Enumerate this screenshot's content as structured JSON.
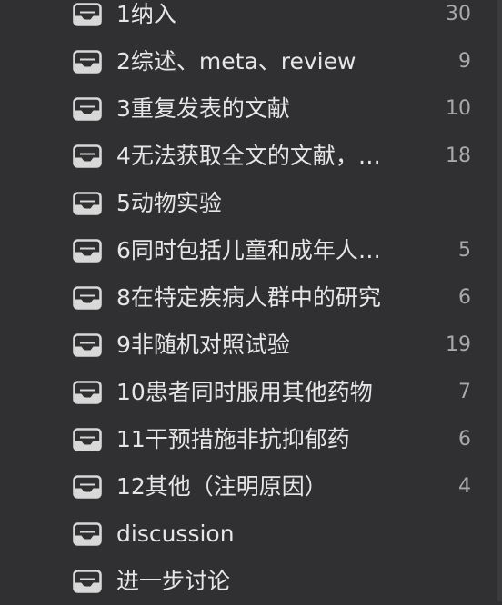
{
  "sidebar": {
    "items": [
      {
        "label": "1纳入",
        "count": "30",
        "icon": "inbox-tray-icon"
      },
      {
        "label": "2综述、meta、review",
        "count": "9",
        "icon": "inbox-tray-icon"
      },
      {
        "label": "3重复发表的文献",
        "count": "10",
        "icon": "inbox-tray-icon"
      },
      {
        "label": "4无法获取全文的文献，…",
        "count": "18",
        "icon": "inbox-tray-icon"
      },
      {
        "label": "5动物实验",
        "count": "",
        "icon": "inbox-tray-icon"
      },
      {
        "label": "6同时包括儿童和成年人…",
        "count": "5",
        "icon": "inbox-tray-icon"
      },
      {
        "label": "8在特定疾病人群中的研究",
        "count": "6",
        "icon": "inbox-tray-icon"
      },
      {
        "label": "9非随机对照试验",
        "count": "19",
        "icon": "inbox-tray-icon"
      },
      {
        "label": "10患者同时服用其他药物",
        "count": "7",
        "icon": "inbox-tray-icon"
      },
      {
        "label": "11干预措施非抗抑郁药",
        "count": "6",
        "icon": "inbox-tray-icon"
      },
      {
        "label": "12其他（注明原因）",
        "count": "4",
        "icon": "inbox-tray-icon"
      },
      {
        "label": "discussion",
        "count": "",
        "icon": "inbox-tray-icon"
      },
      {
        "label": "进一步讨论",
        "count": "",
        "icon": "inbox-tray-icon"
      }
    ]
  },
  "colors": {
    "background": "#302f31",
    "label": "#e6e6e6",
    "count": "#a9a8aa",
    "icon": "#d8d8d8"
  }
}
